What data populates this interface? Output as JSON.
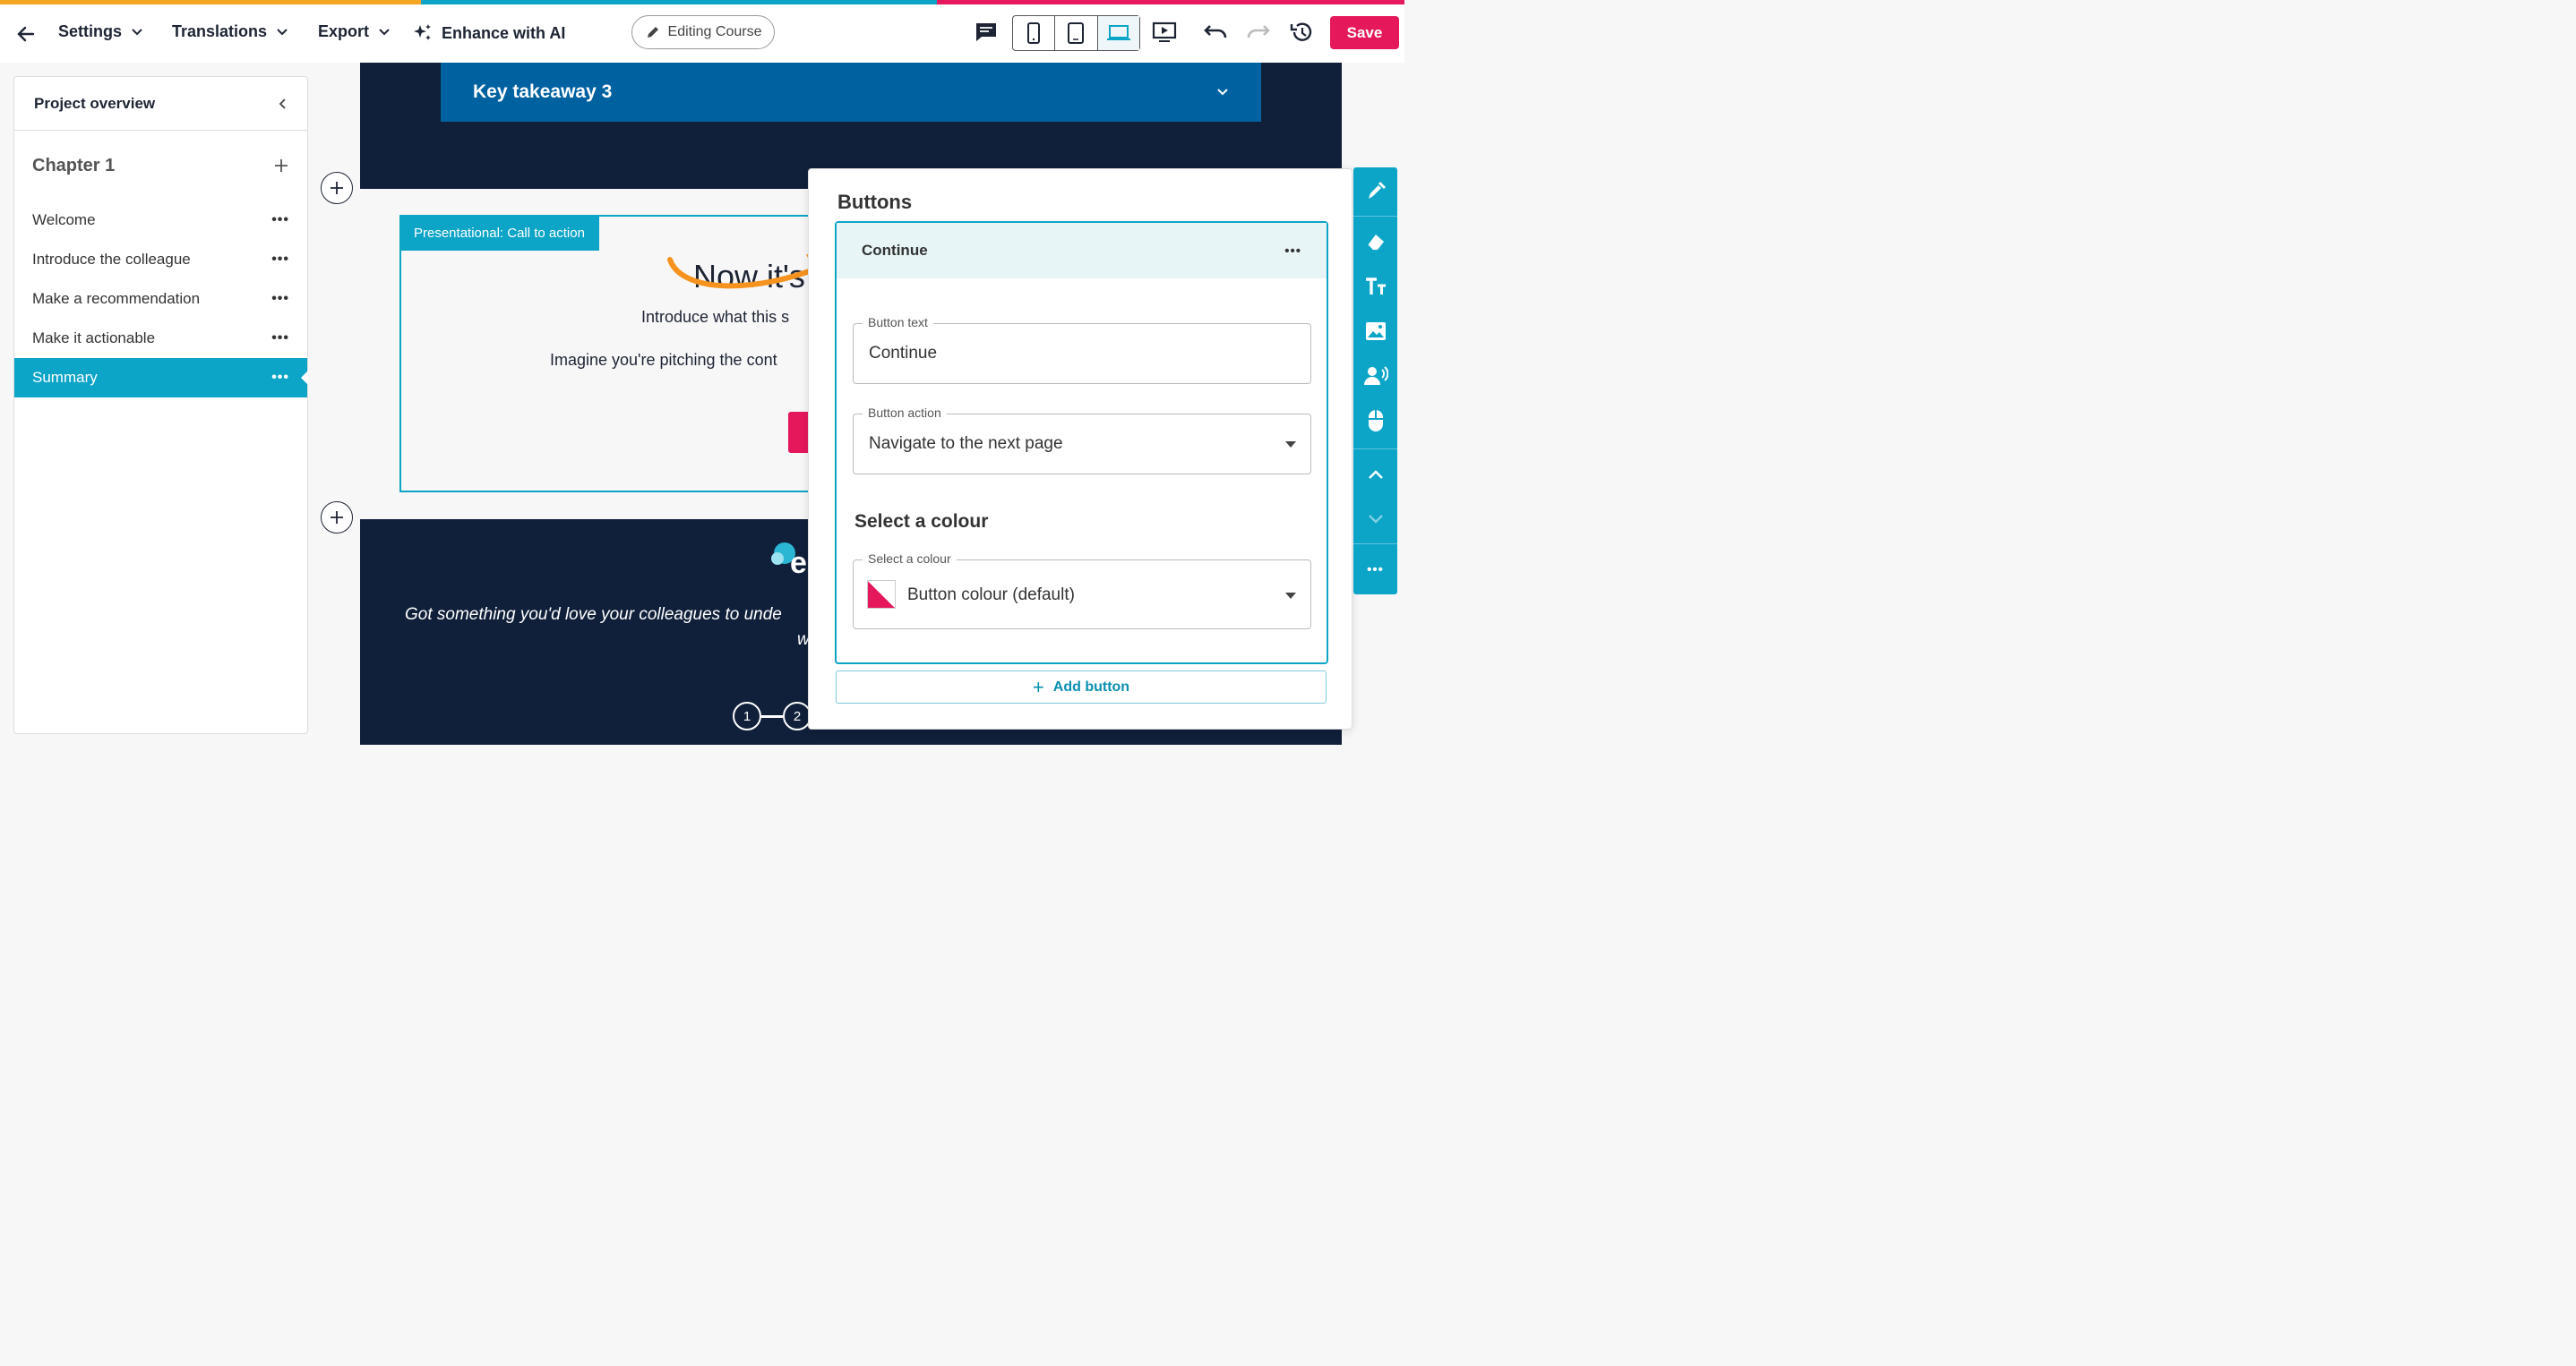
{
  "colors": {
    "accent": "#0ca4c7",
    "save": "#e6185c",
    "dark": "#10203a",
    "takeaway": "#0061a0",
    "stripe": [
      "#f5a623",
      "#0ca4c7",
      "#e6185c"
    ]
  },
  "toolbar": {
    "back_icon": "arrow-left-icon",
    "settings": "Settings",
    "translations": "Translations",
    "export": "Export",
    "enhance": "Enhance with AI",
    "editing": "Editing Course",
    "save": "Save"
  },
  "sidebar": {
    "title": "Project overview",
    "chapter": "Chapter 1",
    "items": [
      {
        "label": "Welcome"
      },
      {
        "label": "Introduce the colleague"
      },
      {
        "label": "Make a recommendation"
      },
      {
        "label": "Make it actionable"
      },
      {
        "label": "Summary",
        "active": true
      }
    ]
  },
  "canvas": {
    "takeaway": "Key takeaway 3",
    "cta_tag": "Presentational: Call to action",
    "cta_title": "Now it's",
    "cta_line1": "Introduce what this s",
    "cta_line2": "Imagine you're pitching the cont",
    "quote": "Got something you'd love your colleagues to unde",
    "quote2": "w",
    "logo_letter": "e",
    "steps": [
      "1",
      "2"
    ]
  },
  "panel": {
    "title": "Buttons",
    "card_title": "Continue",
    "button_text_label": "Button text",
    "button_text_value": "Continue",
    "button_action_label": "Button action",
    "button_action_value": "Navigate to the next page",
    "colour_heading": "Select a colour",
    "colour_label": "Select a colour",
    "colour_value": "Button colour (default)",
    "add_button": "Add button"
  }
}
